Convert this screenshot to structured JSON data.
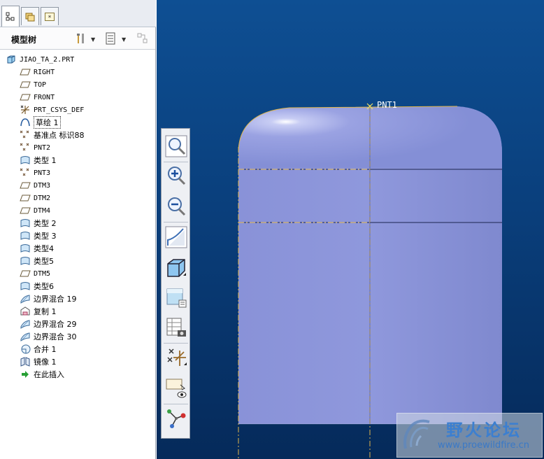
{
  "tabs": [
    {
      "name": "model-tree-tab",
      "icon": "tree-structure-icon",
      "active": true
    },
    {
      "name": "folder-browser-tab",
      "icon": "folders-icon",
      "active": false
    },
    {
      "name": "favorites-tab",
      "icon": "star-icon",
      "active": false
    }
  ],
  "tree_header": {
    "title": "模型树",
    "settings_icon": "tools-icon",
    "show_icon": "list-icon",
    "filter_icon": "filter-icon"
  },
  "tree": {
    "items": [
      {
        "label": "JIAO_TA_2.PRT",
        "icon": "part-icon",
        "cn": false
      },
      {
        "label": "RIGHT",
        "icon": "datum-plane-icon",
        "cn": false
      },
      {
        "label": "TOP",
        "icon": "datum-plane-icon",
        "cn": false
      },
      {
        "label": "FRONT",
        "icon": "datum-plane-icon",
        "cn": false
      },
      {
        "label": "PRT_CSYS_DEF",
        "icon": "csys-icon",
        "cn": false
      },
      {
        "label": "草绘 1",
        "icon": "sketch-icon",
        "cn": true,
        "boxed": true
      },
      {
        "label": "基准点 标识88",
        "icon": "datum-point-icon",
        "cn": true
      },
      {
        "label": "PNT2",
        "icon": "datum-point-icon",
        "cn": false
      },
      {
        "label": "类型 1",
        "icon": "surface-icon",
        "cn": true
      },
      {
        "label": "PNT3",
        "icon": "datum-point-icon",
        "cn": false
      },
      {
        "label": "DTM3",
        "icon": "datum-plane-icon",
        "cn": false
      },
      {
        "label": "DTM2",
        "icon": "datum-plane-icon",
        "cn": false
      },
      {
        "label": "DTM4",
        "icon": "datum-plane-icon",
        "cn": false
      },
      {
        "label": "类型 2",
        "icon": "surface-icon",
        "cn": true
      },
      {
        "label": "类型 3",
        "icon": "surface-icon",
        "cn": true
      },
      {
        "label": "类型4",
        "icon": "surface-icon",
        "cn": true
      },
      {
        "label": "类型5",
        "icon": "surface-icon",
        "cn": true
      },
      {
        "label": "DTM5",
        "icon": "datum-plane-icon",
        "cn": false
      },
      {
        "label": "类型6",
        "icon": "surface-icon",
        "cn": true
      },
      {
        "label": "边界混合 19",
        "icon": "boundary-blend-icon",
        "cn": true
      },
      {
        "label": "复制 1",
        "icon": "copy-icon",
        "cn": true
      },
      {
        "label": "边界混合 29",
        "icon": "boundary-blend-icon",
        "cn": true
      },
      {
        "label": "边界混合 30",
        "icon": "boundary-blend-icon",
        "cn": true
      },
      {
        "label": "合并 1",
        "icon": "merge-icon",
        "cn": true
      },
      {
        "label": "镜像 1",
        "icon": "mirror-icon",
        "cn": true
      },
      {
        "label": "在此插入",
        "icon": "insert-here-arrow-icon",
        "cn": true
      }
    ]
  },
  "viewport": {
    "point_label": "PNT1"
  },
  "view_toolbar": [
    {
      "name": "refit-button",
      "icon": "zoom-fit-icon"
    },
    {
      "name": "zoom-in-button",
      "icon": "zoom-in-icon"
    },
    {
      "name": "zoom-out-button",
      "icon": "zoom-out-icon"
    },
    {
      "name": "repaint-button",
      "icon": "repaint-icon"
    },
    {
      "name": "display-style-button",
      "icon": "shaded-cube-icon"
    },
    {
      "name": "saved-orientations-button",
      "icon": "view-manager-icon"
    },
    {
      "name": "view-settings-button",
      "icon": "camera-table-icon"
    },
    {
      "name": "datum-display-button",
      "icon": "datum-display-icon"
    },
    {
      "name": "annotation-display-button",
      "icon": "annotation-eye-icon"
    },
    {
      "name": "network-button",
      "icon": "network-nodes-icon"
    }
  ],
  "watermark": {
    "title": "野火论坛",
    "url": "www.proewildfire.cn",
    "logo_icon": "wildfire-logo-icon"
  },
  "colors": {
    "viewport_top": "#0e4f93",
    "viewport_bottom": "#052a5a",
    "model_fill": "#8d97db",
    "datum_line": "#e2b64a"
  }
}
